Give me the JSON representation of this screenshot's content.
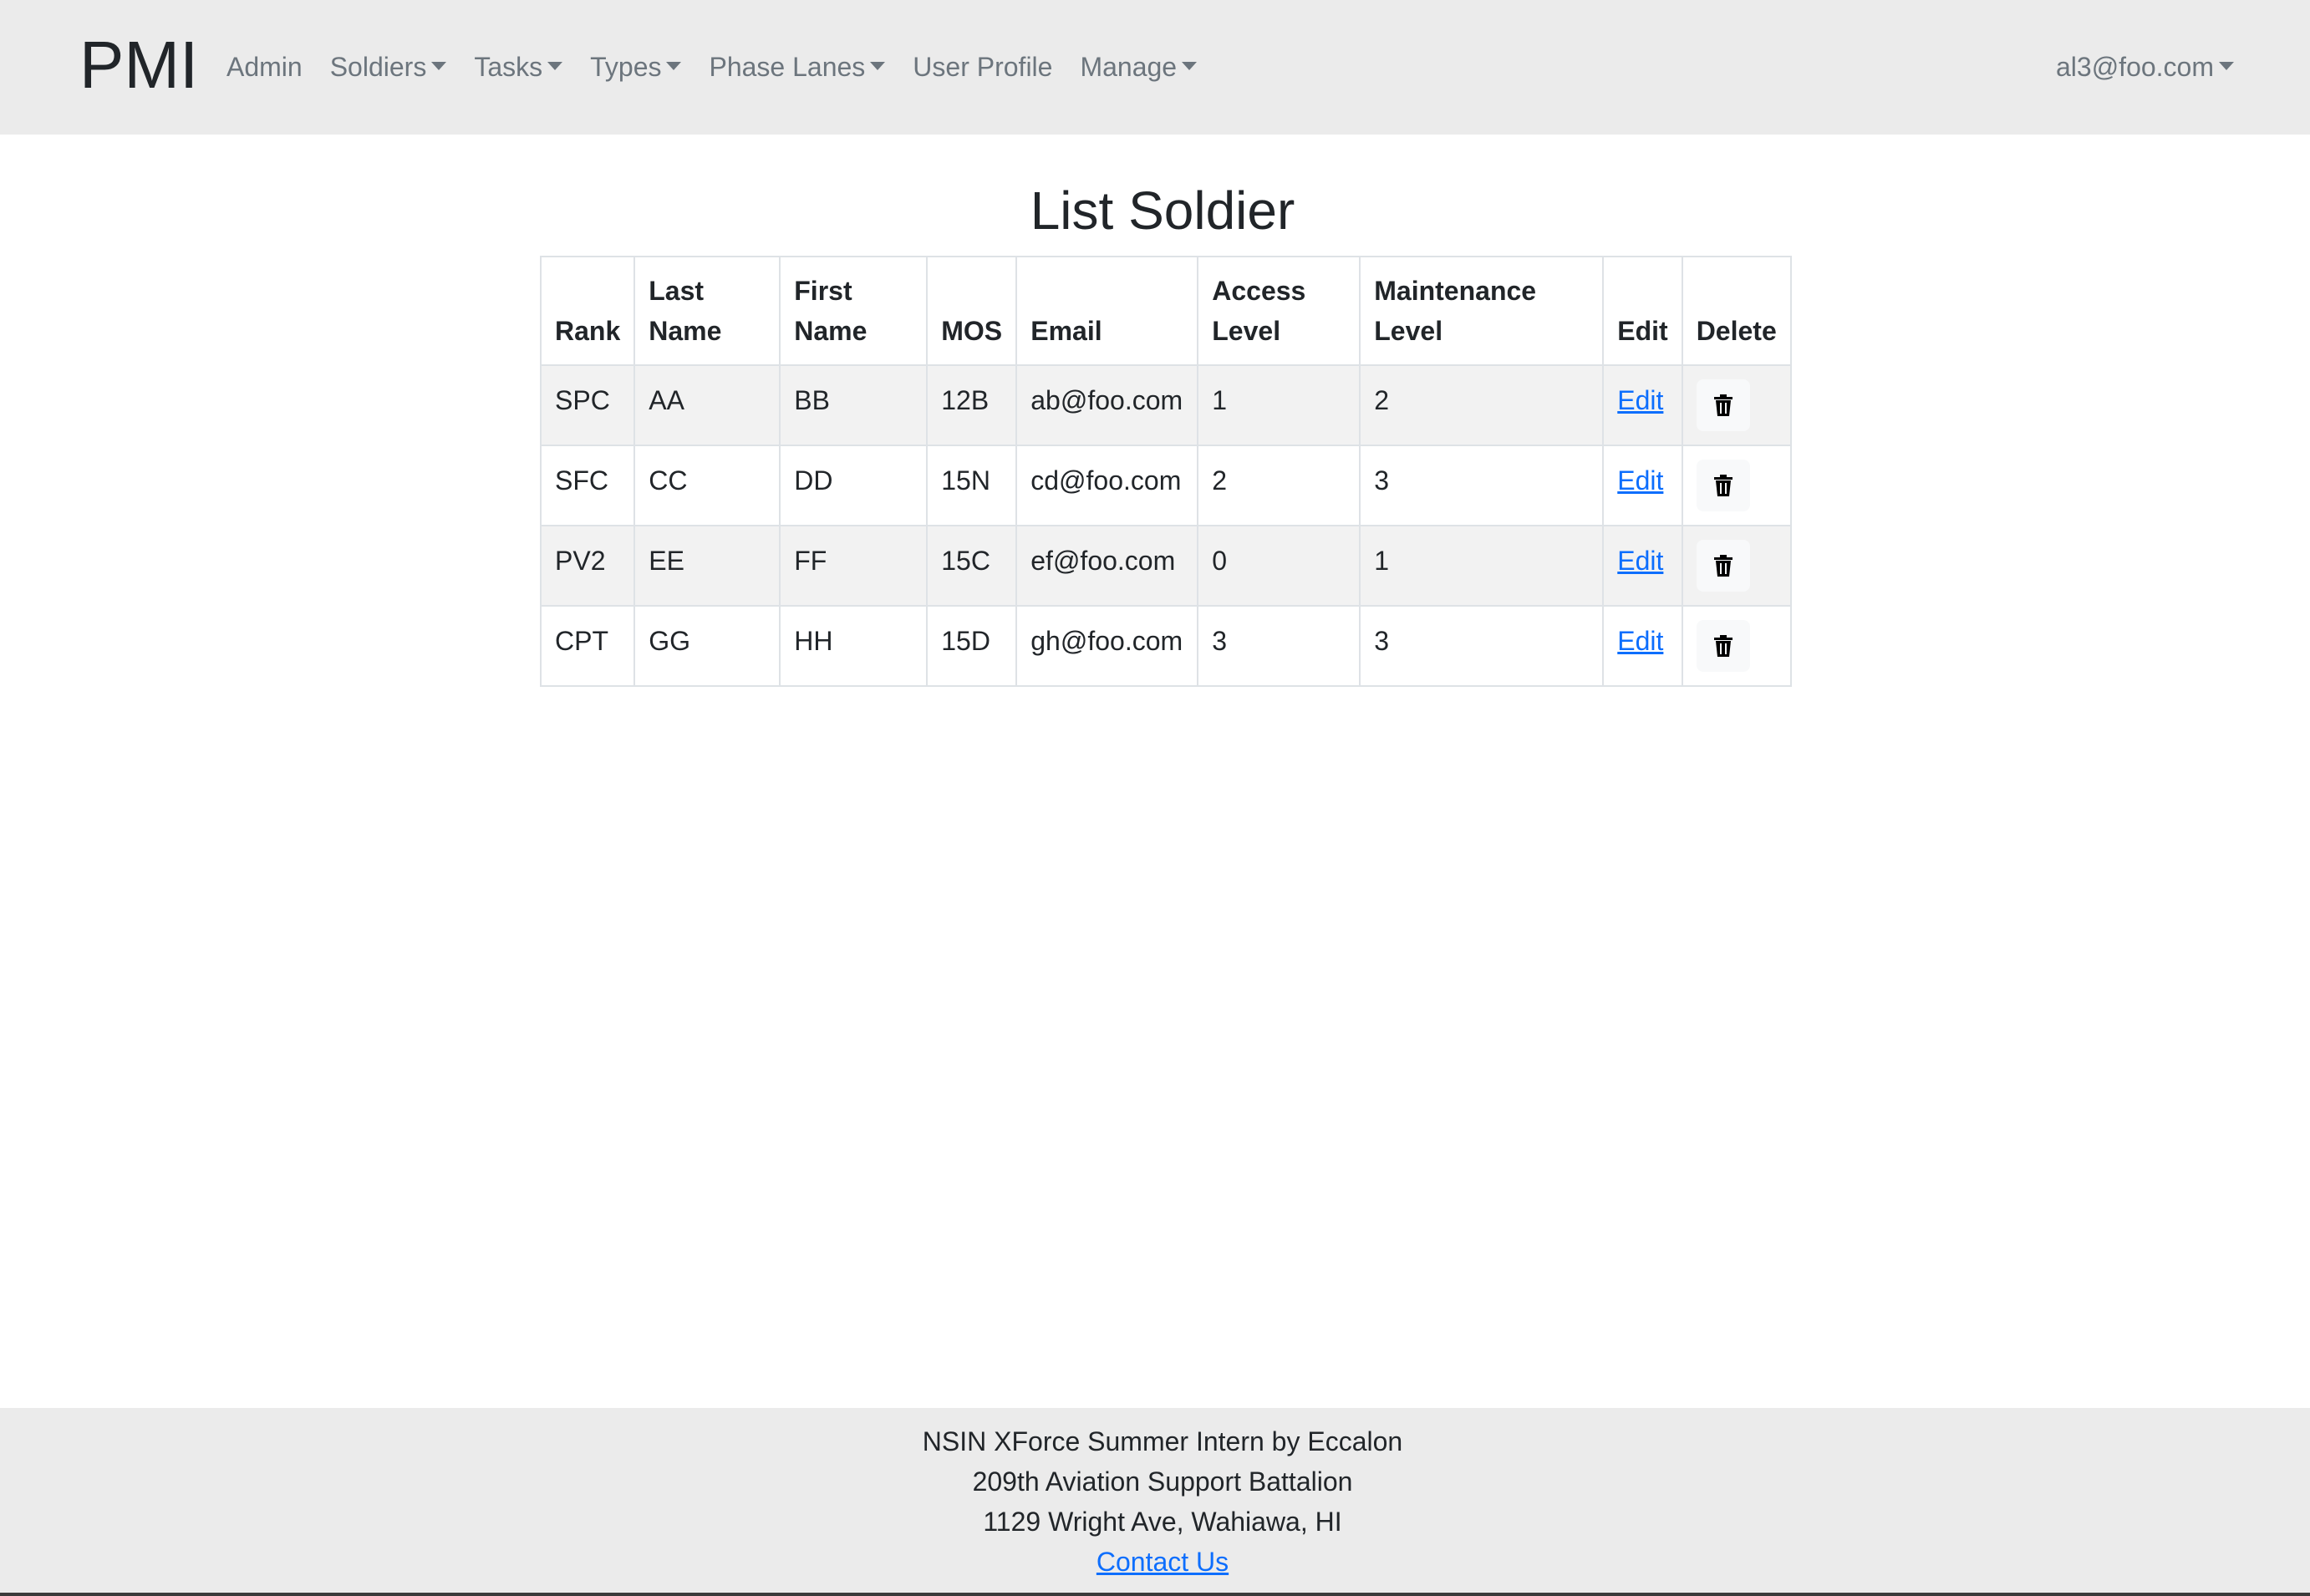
{
  "navbar": {
    "brand": "PMI",
    "items": [
      {
        "label": "Admin",
        "dropdown": false
      },
      {
        "label": "Soldiers",
        "dropdown": true
      },
      {
        "label": "Tasks",
        "dropdown": true
      },
      {
        "label": "Types",
        "dropdown": true
      },
      {
        "label": "Phase Lanes",
        "dropdown": true
      },
      {
        "label": "User Profile",
        "dropdown": false
      },
      {
        "label": "Manage",
        "dropdown": true
      }
    ],
    "user": "al3@foo.com"
  },
  "main": {
    "title": "List Soldier",
    "table": {
      "headers": [
        "Rank",
        "Last Name",
        "First Name",
        "MOS",
        "Email",
        "Access Level",
        "Maintenance Level",
        "Edit",
        "Delete"
      ],
      "rows": [
        {
          "rank": "SPC",
          "last": "AA",
          "first": "BB",
          "mos": "12B",
          "email": "ab@foo.com",
          "access": "1",
          "maint": "2",
          "edit": "Edit"
        },
        {
          "rank": "SFC",
          "last": "CC",
          "first": "DD",
          "mos": "15N",
          "email": "cd@foo.com",
          "access": "2",
          "maint": "3",
          "edit": "Edit"
        },
        {
          "rank": "PV2",
          "last": "EE",
          "first": "FF",
          "mos": "15C",
          "email": "ef@foo.com",
          "access": "0",
          "maint": "1",
          "edit": "Edit"
        },
        {
          "rank": "CPT",
          "last": "GG",
          "first": "HH",
          "mos": "15D",
          "email": "gh@foo.com",
          "access": "3",
          "maint": "3",
          "edit": "Edit"
        }
      ]
    }
  },
  "footer": {
    "line1": "NSIN XForce Summer Intern by Eccalon",
    "line2": "209th Aviation Support Battalion",
    "line3": "1129 Wright Ave, Wahiawa, HI",
    "contact": "Contact Us"
  },
  "colors": {
    "navbar_bg": "#ebebeb",
    "link": "#0d6efd",
    "nav_text": "#6c757d"
  }
}
